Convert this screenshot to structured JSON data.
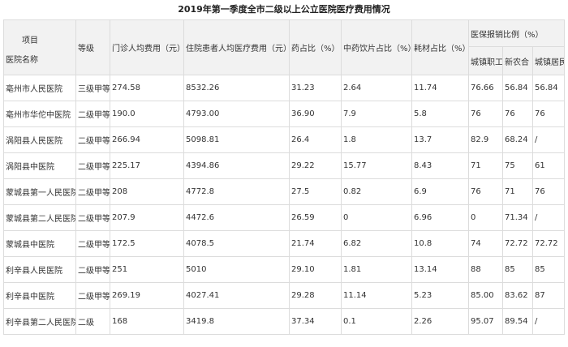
{
  "title": "2019年第一季度全市二级以上公立医院医疗费用情况",
  "header": {
    "item": "项目",
    "name": "医院名称",
    "level": "等级",
    "outpatient": "门诊人均费用（元）",
    "inpatient": "住院患者人均医疗费用（元）",
    "drug_ratio": "药占比（%）",
    "tcm_ratio": "中药饮片占比（%）",
    "consumable_ratio": "耗材占比（%）",
    "insurance": "医保报销比例（%）",
    "urban_worker": "城镇职工",
    "ncms": "新农合",
    "urban_resident": "城镇居民"
  },
  "rows": [
    {
      "name": "亳州市人民医院",
      "level": "三级甲等",
      "outpatient": "274.58",
      "inpatient": "8532.26",
      "drug": "31.23",
      "tcm": "2.64",
      "consumable": "11.74",
      "worker": "76.66",
      "ncms": "56.84",
      "resident": "56.84"
    },
    {
      "name": "亳州市华佗中医院",
      "level": "二级甲等",
      "outpatient": "190.0",
      "inpatient": "4793.00",
      "drug": "36.90",
      "tcm": "7.9",
      "consumable": "5.8",
      "worker": "76",
      "ncms": "76",
      "resident": "76"
    },
    {
      "name": "涡阳县人民医院",
      "level": "二级甲等",
      "outpatient": "266.94",
      "inpatient": "5098.81",
      "drug": "26.4",
      "tcm": "1.8",
      "consumable": "13.7",
      "worker": "82.9",
      "ncms": "68.24",
      "resident": "/"
    },
    {
      "name": "涡阳县中医院",
      "level": "二级甲等",
      "outpatient": "225.17",
      "inpatient": "4394.86",
      "drug": "29.22",
      "tcm": "15.77",
      "consumable": "8.43",
      "worker": "71",
      "ncms": "75",
      "resident": "61"
    },
    {
      "name": "蒙城县第一人民医院",
      "level": "二级甲等",
      "outpatient": "208",
      "inpatient": "4772.8",
      "drug": "27.5",
      "tcm": "0.82",
      "consumable": "6.9",
      "worker": "76",
      "ncms": "71",
      "resident": "76"
    },
    {
      "name": "蒙城县第二人民医院",
      "level": "二级甲等",
      "outpatient": "207.9",
      "inpatient": "4472.6",
      "drug": "26.59",
      "tcm": "0",
      "consumable": "6.96",
      "worker": "0",
      "ncms": "71.34",
      "resident": "/"
    },
    {
      "name": "蒙城县中医院",
      "level": "二级甲等",
      "outpatient": "172.5",
      "inpatient": "4078.5",
      "drug": "21.74",
      "tcm": "6.82",
      "consumable": "10.8",
      "worker": "74",
      "ncms": "72.72",
      "resident": "72.72"
    },
    {
      "name": "利辛县人民医院",
      "level": "二级甲等",
      "outpatient": "251",
      "inpatient": "5010",
      "drug": "29.10",
      "tcm": "1.81",
      "consumable": "13.14",
      "worker": "88",
      "ncms": "85",
      "resident": "85"
    },
    {
      "name": "利辛县中医院",
      "level": "二级甲等",
      "outpatient": "269.19",
      "inpatient": "4027.41",
      "drug": "29.28",
      "tcm": "11.14",
      "consumable": "5.23",
      "worker": "85.00",
      "ncms": "83.62",
      "resident": "87"
    },
    {
      "name": "利辛县第二人民医院",
      "level": "二级",
      "outpatient": "168",
      "inpatient": "3419.8",
      "drug": "37.34",
      "tcm": "0.1",
      "consumable": "2.26",
      "worker": "95.07",
      "ncms": "89.54",
      "resident": "/"
    }
  ]
}
